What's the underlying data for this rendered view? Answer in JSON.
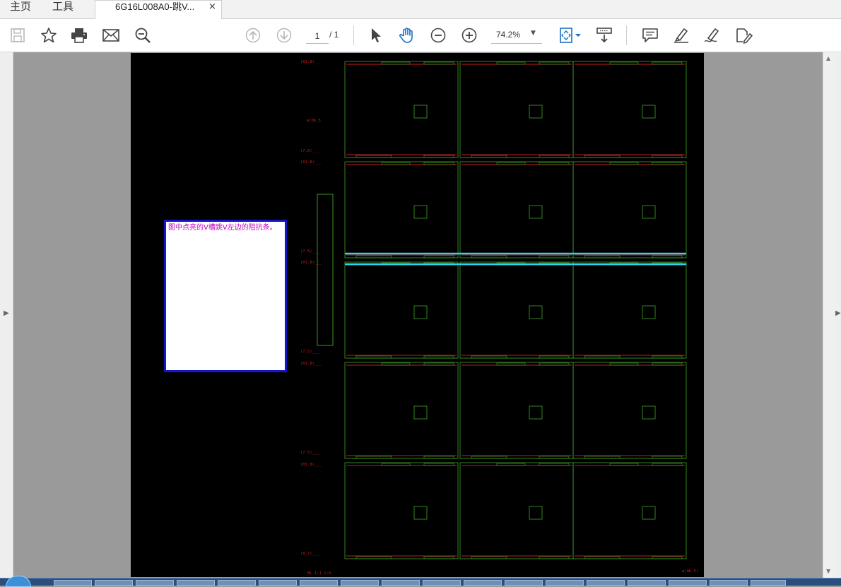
{
  "tabs": {
    "home_label": "主页",
    "tools_label": "工具",
    "document_title": "6G16L008A0-跳V...",
    "close_symbol": "×"
  },
  "toolbar": {
    "icons": [
      "save-icon",
      "bookmark-star-icon",
      "print-icon",
      "email-icon",
      "search-zoom-icon",
      "page-up-icon",
      "page-down-icon",
      "select-cursor-icon",
      "hand-icon",
      "zoom-out-icon",
      "zoom-in-icon",
      "fit-page-icon",
      "scroll-mode-icon",
      "comment-icon",
      "highlight-icon",
      "sign-icon",
      "edit-icon"
    ],
    "page_current": "1",
    "page_total": "/ 1",
    "zoom_value": "74.2%",
    "zoom_caret": "▼"
  },
  "note": {
    "text": "图中点亮的V槽跳V左边的阻抗条。"
  },
  "colors": {
    "accent_blue": "#1a6fc4",
    "cad_green": "#3fa52a",
    "cad_red": "#c81e1e",
    "cad_cyan": "#28d6f0",
    "note_border": "#1414c8",
    "note_text": "#c000c0"
  },
  "cad": {
    "labels_left": [
      "(01.8)___",
      "ø(0b.5",
      "(7.5)___",
      "(01.8)___",
      "(7.5)___",
      "(01.8)___",
      "(7.5)___",
      "(01.8)___",
      "(7.5)___",
      "(01.8)___",
      "(8.7)___"
    ],
    "label_bottom_left": "ML.1:1 1:0",
    "label_bottom_right": "ø(0b.5)"
  }
}
